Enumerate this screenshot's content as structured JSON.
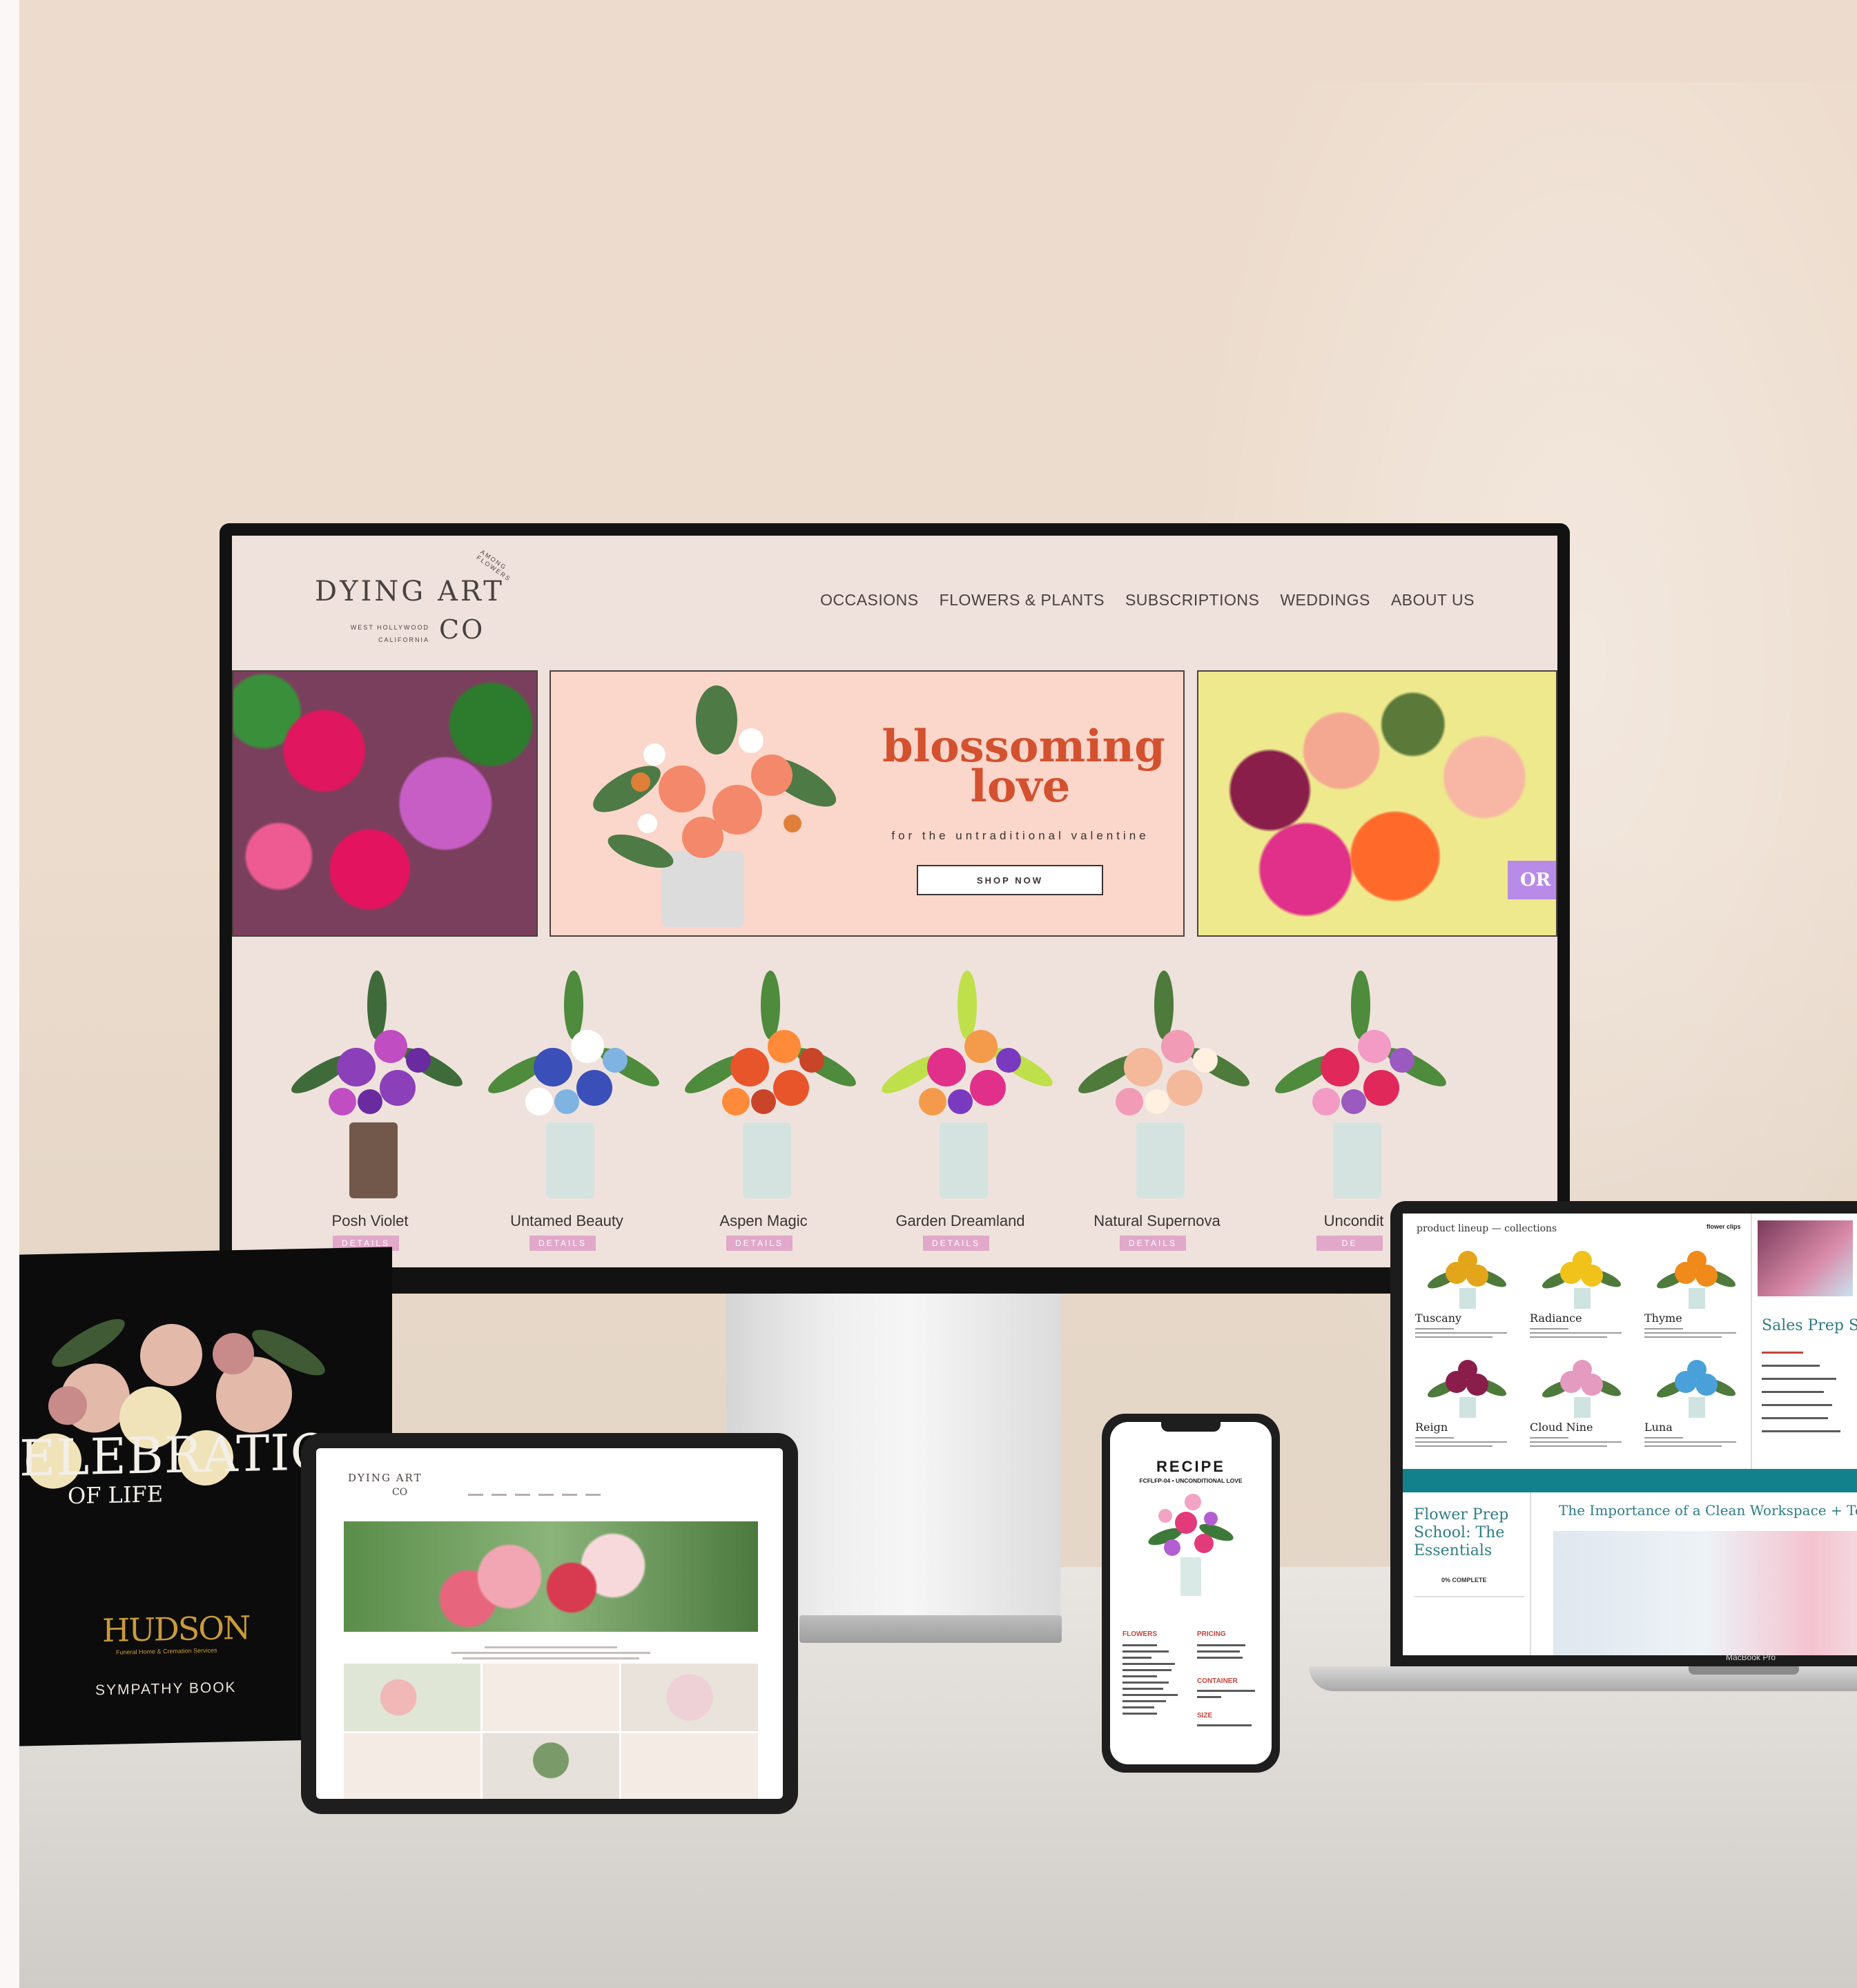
{
  "website": {
    "logo": {
      "main": "DYING ART",
      "co": "CO",
      "location_line1": "WEST HOLLYWOOD",
      "location_line2": "CALIFORNIA",
      "arc": "AMONG FLOWERS"
    },
    "nav": [
      "OCCASIONS",
      "FLOWERS & PLANTS",
      "SUBSCRIPTIONS",
      "WEDDINGS",
      "ABOUT US"
    ],
    "hero": {
      "title_line1": "blossoming",
      "title_line2": "love",
      "tagline": "for the untraditional valentine",
      "button": "SHOP NOW",
      "right_chip": "OR"
    },
    "products": [
      {
        "name": "Posh Violet",
        "button": "DETAILS"
      },
      {
        "name": "Untamed Beauty",
        "button": "DETAILS"
      },
      {
        "name": "Aspen Magic",
        "button": "DETAILS"
      },
      {
        "name": "Garden Dreamland",
        "button": "DETAILS"
      },
      {
        "name": "Natural Supernova",
        "button": "DETAILS"
      },
      {
        "name": "Uncondit",
        "button": "DE"
      }
    ]
  },
  "book": {
    "title": "ELEBRATIO",
    "subtitle": "OF LIFE",
    "brand": "HUDSON",
    "brand_sub": "Funeral Home & Cremation Services",
    "label": "SYMPATHY BOOK"
  },
  "tablet": {
    "logo": "DYING ART",
    "co": "CO"
  },
  "phone": {
    "title": "RECIPE",
    "subtitle": "FCFLFP-04 • UNCONDITIONAL LOVE",
    "section_flowers": "FLOWERS",
    "section_pricing": "PRICING",
    "section_container": "CONTAINER",
    "section_size": "SIZE"
  },
  "laptop": {
    "header": "product lineup — collections",
    "header_right": "flower clips",
    "cards": [
      "Tuscany",
      "Radiance",
      "Thyme",
      "Reign",
      "Cloud Nine",
      "Luna"
    ],
    "right_title": "Sales Prep Scho",
    "bottom_left_title": "Flower Prep School: The Essentials",
    "bottom_left_complete": "0% COMPLETE",
    "bottom_right_title": "The Importance of a Clean Workspace + Tools",
    "model": "MacBook Pro"
  },
  "colors": {
    "hero_title": "#d3512f",
    "details_button": "#e1a8c9",
    "teal": "#12818b",
    "gold": "#c99b3b"
  }
}
